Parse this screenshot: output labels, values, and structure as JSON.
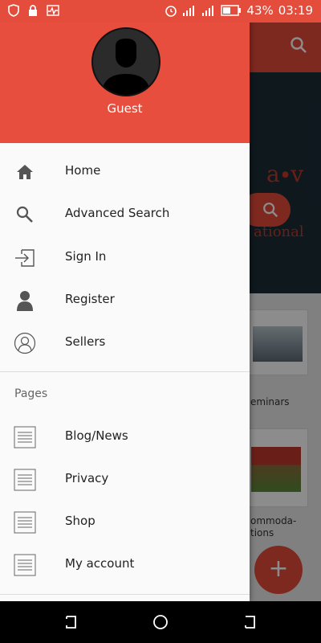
{
  "status_bar": {
    "battery": "43",
    "battery_unit": "%",
    "time": "03:19",
    "icons": [
      "shield-icon",
      "lock-icon",
      "activity-icon",
      "alarm-icon",
      "signal-icon",
      "signal-icon",
      "battery-icon"
    ]
  },
  "drawer": {
    "username": "Guest",
    "section_title": "Pages",
    "main_items": [
      {
        "label": "Home",
        "icon": "home-icon"
      },
      {
        "label": "Advanced Search",
        "icon": "search-icon"
      },
      {
        "label": "Sign In",
        "icon": "sign-in-icon"
      },
      {
        "label": "Register",
        "icon": "person-icon"
      },
      {
        "label": "Sellers",
        "icon": "user-circle-icon"
      }
    ],
    "page_items": [
      {
        "label": "Blog/News",
        "icon": "page-icon"
      },
      {
        "label": "Privacy",
        "icon": "page-icon"
      },
      {
        "label": "Shop",
        "icon": "page-icon"
      },
      {
        "label": "My account",
        "icon": "page-icon"
      }
    ]
  },
  "background": {
    "card1_caption": "eminars",
    "card2_caption_line1": "ommoda-",
    "card2_caption_line2": "tions",
    "hero_text": "a∙v",
    "hero_sub": "ational"
  },
  "colors": {
    "accent": "#e84e3d",
    "drawer_bg": "#fafafa"
  }
}
